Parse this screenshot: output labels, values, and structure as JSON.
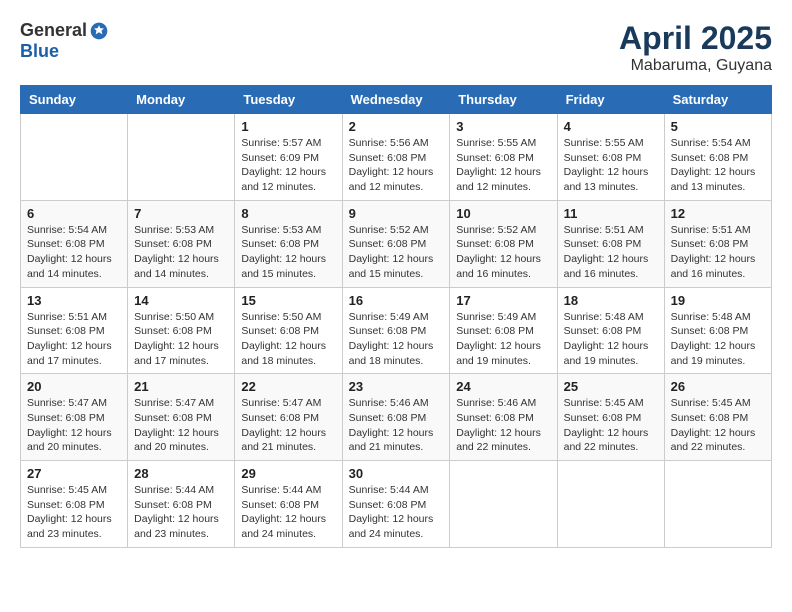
{
  "header": {
    "logo_general": "General",
    "logo_blue": "Blue",
    "month": "April 2025",
    "location": "Mabaruma, Guyana"
  },
  "weekdays": [
    "Sunday",
    "Monday",
    "Tuesday",
    "Wednesday",
    "Thursday",
    "Friday",
    "Saturday"
  ],
  "weeks": [
    [
      {
        "day": "",
        "info": ""
      },
      {
        "day": "",
        "info": ""
      },
      {
        "day": "1",
        "info": "Sunrise: 5:57 AM\nSunset: 6:09 PM\nDaylight: 12 hours and 12 minutes."
      },
      {
        "day": "2",
        "info": "Sunrise: 5:56 AM\nSunset: 6:08 PM\nDaylight: 12 hours and 12 minutes."
      },
      {
        "day": "3",
        "info": "Sunrise: 5:55 AM\nSunset: 6:08 PM\nDaylight: 12 hours and 12 minutes."
      },
      {
        "day": "4",
        "info": "Sunrise: 5:55 AM\nSunset: 6:08 PM\nDaylight: 12 hours and 13 minutes."
      },
      {
        "day": "5",
        "info": "Sunrise: 5:54 AM\nSunset: 6:08 PM\nDaylight: 12 hours and 13 minutes."
      }
    ],
    [
      {
        "day": "6",
        "info": "Sunrise: 5:54 AM\nSunset: 6:08 PM\nDaylight: 12 hours and 14 minutes."
      },
      {
        "day": "7",
        "info": "Sunrise: 5:53 AM\nSunset: 6:08 PM\nDaylight: 12 hours and 14 minutes."
      },
      {
        "day": "8",
        "info": "Sunrise: 5:53 AM\nSunset: 6:08 PM\nDaylight: 12 hours and 15 minutes."
      },
      {
        "day": "9",
        "info": "Sunrise: 5:52 AM\nSunset: 6:08 PM\nDaylight: 12 hours and 15 minutes."
      },
      {
        "day": "10",
        "info": "Sunrise: 5:52 AM\nSunset: 6:08 PM\nDaylight: 12 hours and 16 minutes."
      },
      {
        "day": "11",
        "info": "Sunrise: 5:51 AM\nSunset: 6:08 PM\nDaylight: 12 hours and 16 minutes."
      },
      {
        "day": "12",
        "info": "Sunrise: 5:51 AM\nSunset: 6:08 PM\nDaylight: 12 hours and 16 minutes."
      }
    ],
    [
      {
        "day": "13",
        "info": "Sunrise: 5:51 AM\nSunset: 6:08 PM\nDaylight: 12 hours and 17 minutes."
      },
      {
        "day": "14",
        "info": "Sunrise: 5:50 AM\nSunset: 6:08 PM\nDaylight: 12 hours and 17 minutes."
      },
      {
        "day": "15",
        "info": "Sunrise: 5:50 AM\nSunset: 6:08 PM\nDaylight: 12 hours and 18 minutes."
      },
      {
        "day": "16",
        "info": "Sunrise: 5:49 AM\nSunset: 6:08 PM\nDaylight: 12 hours and 18 minutes."
      },
      {
        "day": "17",
        "info": "Sunrise: 5:49 AM\nSunset: 6:08 PM\nDaylight: 12 hours and 19 minutes."
      },
      {
        "day": "18",
        "info": "Sunrise: 5:48 AM\nSunset: 6:08 PM\nDaylight: 12 hours and 19 minutes."
      },
      {
        "day": "19",
        "info": "Sunrise: 5:48 AM\nSunset: 6:08 PM\nDaylight: 12 hours and 19 minutes."
      }
    ],
    [
      {
        "day": "20",
        "info": "Sunrise: 5:47 AM\nSunset: 6:08 PM\nDaylight: 12 hours and 20 minutes."
      },
      {
        "day": "21",
        "info": "Sunrise: 5:47 AM\nSunset: 6:08 PM\nDaylight: 12 hours and 20 minutes."
      },
      {
        "day": "22",
        "info": "Sunrise: 5:47 AM\nSunset: 6:08 PM\nDaylight: 12 hours and 21 minutes."
      },
      {
        "day": "23",
        "info": "Sunrise: 5:46 AM\nSunset: 6:08 PM\nDaylight: 12 hours and 21 minutes."
      },
      {
        "day": "24",
        "info": "Sunrise: 5:46 AM\nSunset: 6:08 PM\nDaylight: 12 hours and 22 minutes."
      },
      {
        "day": "25",
        "info": "Sunrise: 5:45 AM\nSunset: 6:08 PM\nDaylight: 12 hours and 22 minutes."
      },
      {
        "day": "26",
        "info": "Sunrise: 5:45 AM\nSunset: 6:08 PM\nDaylight: 12 hours and 22 minutes."
      }
    ],
    [
      {
        "day": "27",
        "info": "Sunrise: 5:45 AM\nSunset: 6:08 PM\nDaylight: 12 hours and 23 minutes."
      },
      {
        "day": "28",
        "info": "Sunrise: 5:44 AM\nSunset: 6:08 PM\nDaylight: 12 hours and 23 minutes."
      },
      {
        "day": "29",
        "info": "Sunrise: 5:44 AM\nSunset: 6:08 PM\nDaylight: 12 hours and 24 minutes."
      },
      {
        "day": "30",
        "info": "Sunrise: 5:44 AM\nSunset: 6:08 PM\nDaylight: 12 hours and 24 minutes."
      },
      {
        "day": "",
        "info": ""
      },
      {
        "day": "",
        "info": ""
      },
      {
        "day": "",
        "info": ""
      }
    ]
  ]
}
